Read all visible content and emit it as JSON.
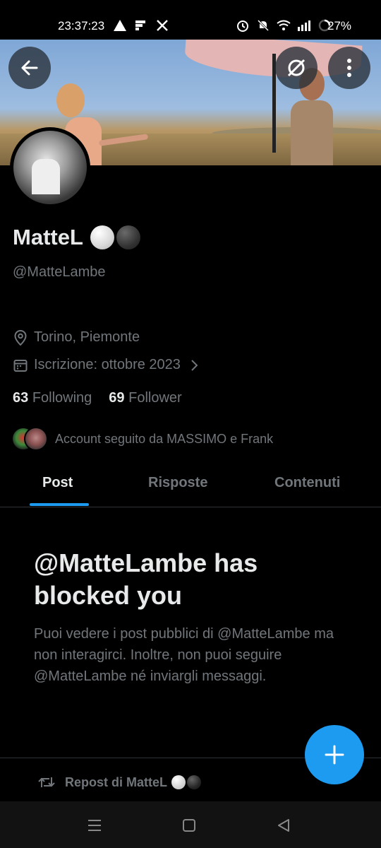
{
  "status_bar": {
    "time": "23:37:23",
    "battery": "27%",
    "icons_left": [
      "navigation-arrow-icon",
      "flipboard-icon",
      "x-logo-icon"
    ],
    "icons_right": [
      "alarm-icon",
      "mute-icon",
      "wifi-icon",
      "signal-icon",
      "battery-ring-icon"
    ]
  },
  "header": {
    "back_icon": "arrow-left-icon",
    "grok_icon": "grok-icon",
    "more_icon": "more-vertical-icon"
  },
  "profile": {
    "name": "MatteL",
    "handle": "@MatteLambe",
    "location": "Torino, Piemonte",
    "joined": "Iscrizione: ottobre 2023",
    "following_count": "63",
    "following_label": "Following",
    "followers_count": "69",
    "followers_label": "Follower",
    "followed_by": "Account seguito da MASSIMO e Frank"
  },
  "tabs": [
    {
      "label": "Post",
      "active": true
    },
    {
      "label": "Risposte",
      "active": false
    },
    {
      "label": "Contenuti",
      "active": false
    }
  ],
  "blocked": {
    "title": "@MatteLambe has blocked you",
    "text": "Puoi vedere i post pubblici di @MatteLambe ma non interagirci. Inoltre, non puoi seguire @MatteLambe né inviargli messaggi."
  },
  "repost": {
    "label": "Repost di MatteL"
  },
  "colors": {
    "accent": "#1d9bf0",
    "background": "#000000",
    "muted_text": "#71767b",
    "primary_text": "#e7e9ea"
  }
}
